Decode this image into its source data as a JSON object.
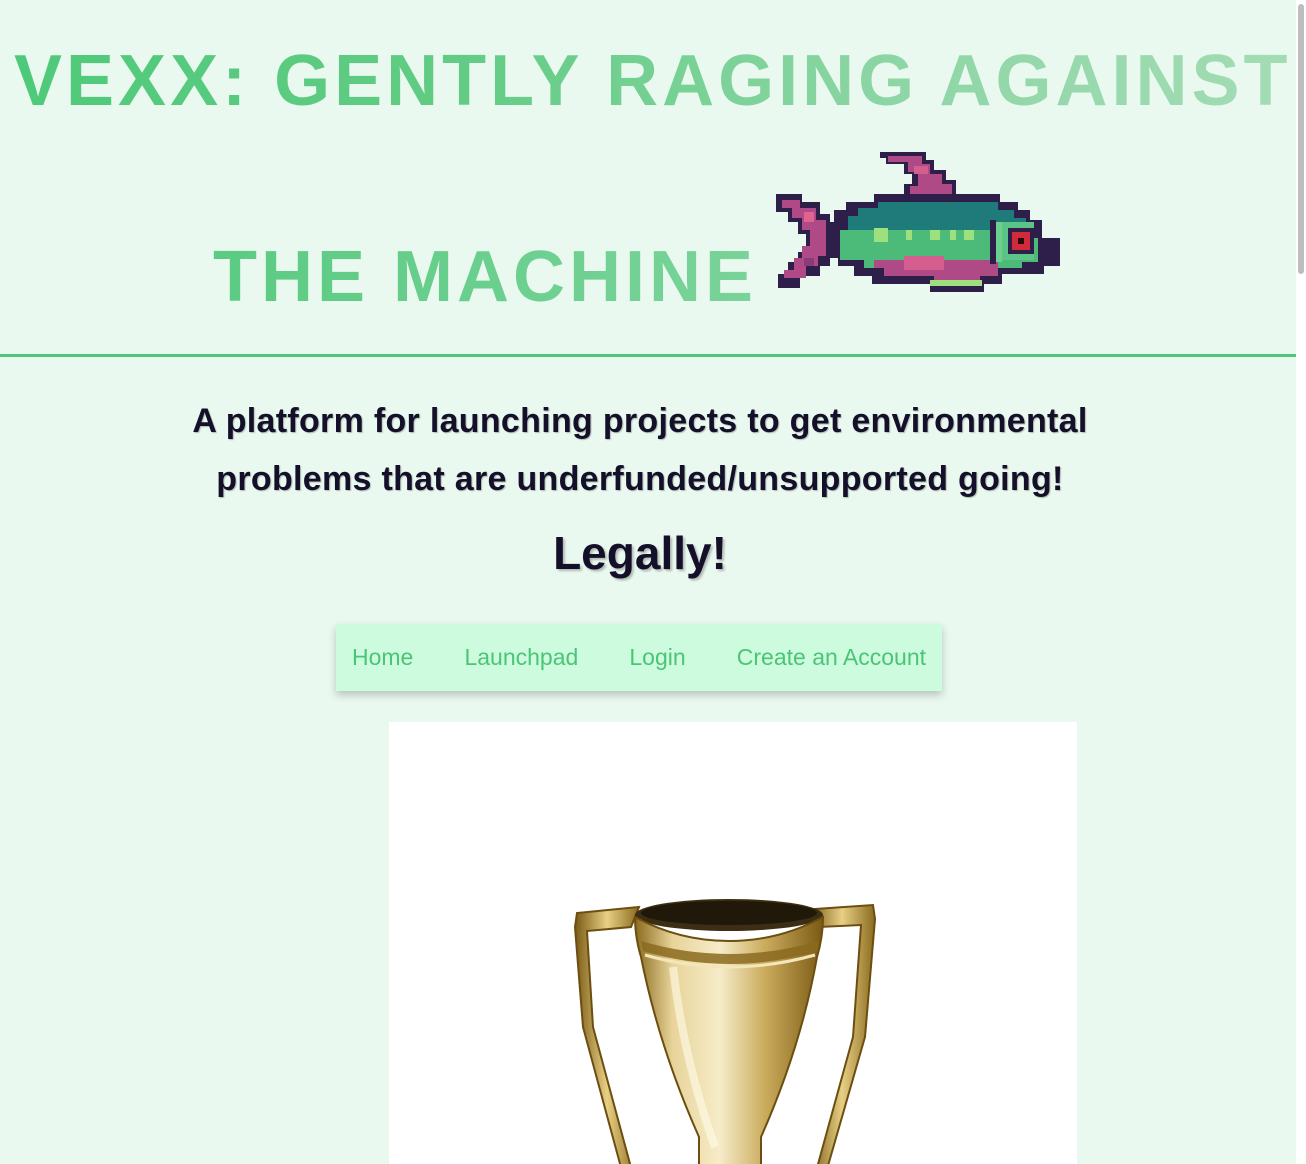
{
  "header": {
    "title_line1": "VEXX: GENTLY RAGING AGAINST",
    "title_line2": "THE MACHINE",
    "fish_icon": "pixel-fish-icon"
  },
  "tagline": {
    "line1": "A platform for launching projects to get environmental",
    "line2": "problems that are underfunded/unsupported going!"
  },
  "subheading": "Legally!",
  "nav": {
    "items": [
      {
        "label": "Home"
      },
      {
        "label": "Launchpad"
      },
      {
        "label": "Login"
      },
      {
        "label": "Create an Account"
      }
    ]
  },
  "hero_image": {
    "icon": "trophy-image"
  },
  "colors": {
    "accent": "#4fc77a",
    "background": "#eaf9ef",
    "nav_background": "#ccfcdd",
    "text_dark": "#15102a"
  }
}
